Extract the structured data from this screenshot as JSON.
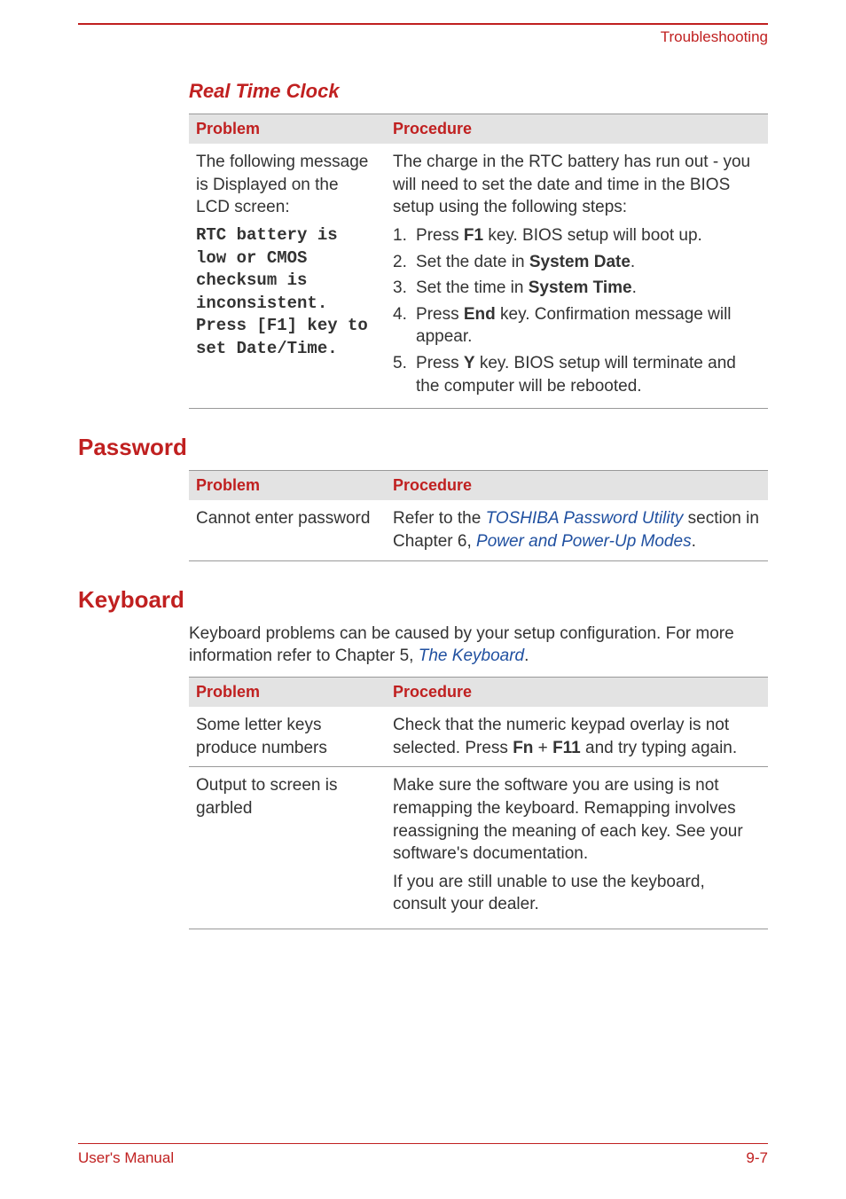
{
  "header": {
    "section": "Troubleshooting"
  },
  "rtc": {
    "heading": "Real Time Clock",
    "th_problem": "Problem",
    "th_procedure": "Procedure",
    "problem_intro": "The following message is Displayed on the LCD screen:",
    "problem_msg1": "RTC battery is low or CMOS checksum is inconsistent.",
    "problem_msg2": "Press [F1] key to set Date/Time.",
    "proc_intro": "The charge in the RTC battery has run out - you will need to set the date and time in the BIOS setup using the following steps:",
    "steps": {
      "s1a": "Press ",
      "s1b": "F1",
      "s1c": " key. BIOS setup will boot up.",
      "s2a": "Set the date in ",
      "s2b": "System Date",
      "s2c": ".",
      "s3a": "Set the time in ",
      "s3b": "System Time",
      "s3c": ".",
      "s4a": "Press ",
      "s4b": "End",
      "s4c": " key. Confirmation message will appear.",
      "s5a": "Press ",
      "s5b": "Y",
      "s5c": " key. BIOS setup will terminate and the computer will be rebooted."
    }
  },
  "password": {
    "heading": "Password",
    "th_problem": "Problem",
    "th_procedure": "Procedure",
    "problem": "Cannot enter password",
    "proc_a": "Refer to the ",
    "proc_link1": "TOSHIBA Password Utility",
    "proc_b": " section in Chapter 6, ",
    "proc_link2": "Power and Power-Up Modes",
    "proc_c": "."
  },
  "keyboard": {
    "heading": "Keyboard",
    "intro_a": "Keyboard problems can be caused by your setup configuration. For more information refer to Chapter 5, ",
    "intro_link": "The Keyboard",
    "intro_b": ".",
    "th_problem": "Problem",
    "th_procedure": "Procedure",
    "row1_problem": "Some letter keys produce numbers",
    "row1_proc_a": "Check that the numeric keypad overlay is not selected. Press ",
    "row1_proc_b": "Fn",
    "row1_proc_c": " + ",
    "row1_proc_d": "F11",
    "row1_proc_e": " and try typing again.",
    "row2_problem": "Output to screen is garbled",
    "row2_proc1": "Make sure the software you are using is not remapping the keyboard. Remapping involves reassigning the meaning of each key. See your software's documentation.",
    "row2_proc2": "If you are still unable to use the keyboard, consult your dealer."
  },
  "footer": {
    "left": "User's Manual",
    "right": "9-7"
  }
}
